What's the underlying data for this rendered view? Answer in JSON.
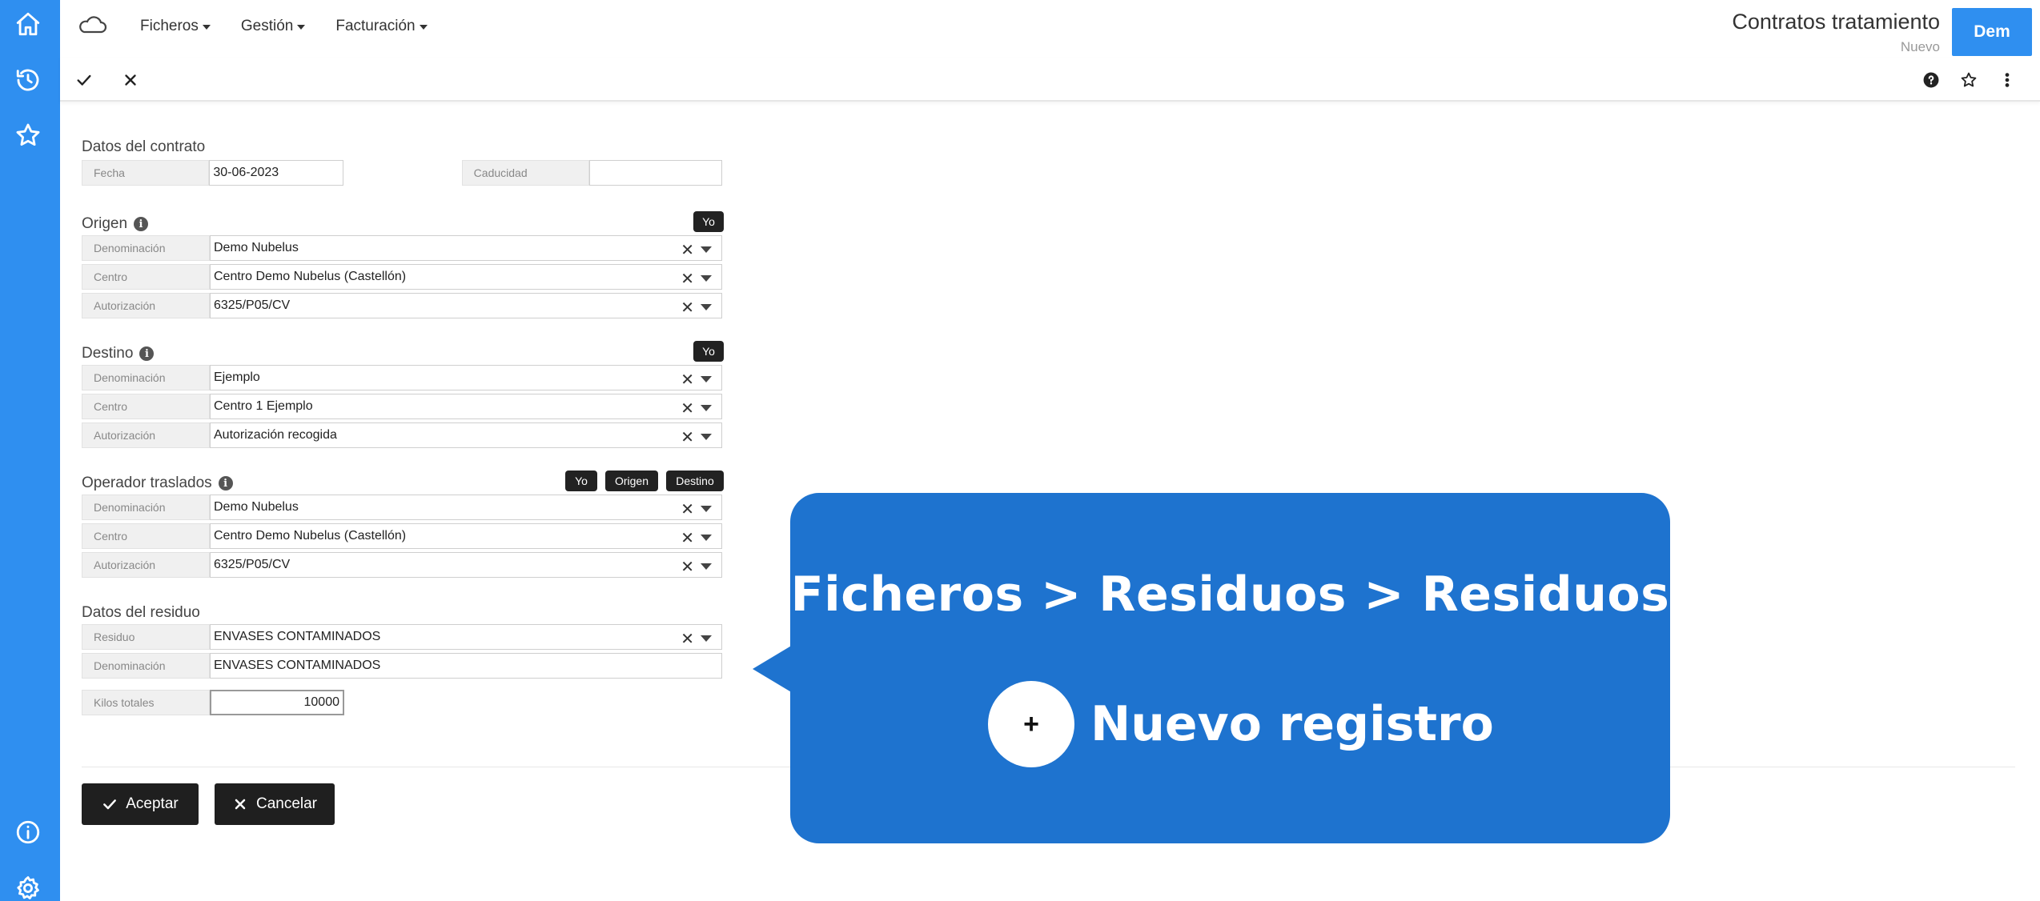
{
  "app": {
    "icons": {
      "logo": "cloud-logo-icon",
      "home": "home-icon",
      "history": "history-icon",
      "favorites": "star-icon",
      "info": "info-icon",
      "settings": "gear-icon"
    },
    "accent_color": "#2f8ff0"
  },
  "menu": [
    {
      "label": "Ficheros"
    },
    {
      "label": "Gestión"
    },
    {
      "label": "Facturación"
    }
  ],
  "header": {
    "title": "Contratos tratamiento",
    "status": "Nuevo",
    "user_label": "Dem"
  },
  "toolbar": {
    "confirm_icon": "check-icon",
    "cancel_icon": "close-icon",
    "help_icon": "help-icon",
    "favorite_icon": "star-icon",
    "more_icon": "more-vertical-icon"
  },
  "contract": {
    "title": "Datos del contrato",
    "date_label": "Fecha",
    "date_value": "30-06-2023",
    "expiry_label": "Caducidad",
    "expiry_value": ""
  },
  "origin": {
    "title": "Origen",
    "button_yo": "Yo",
    "rows": [
      {
        "label": "Denominación",
        "value": "Demo Nubelus"
      },
      {
        "label": "Centro",
        "value": "Centro Demo Nubelus (Castellón)"
      },
      {
        "label": "Autorización",
        "value": "6325/P05/CV"
      }
    ]
  },
  "destination": {
    "title": "Destino",
    "button_yo": "Yo",
    "rows": [
      {
        "label": "Denominación",
        "value": "Ejemplo"
      },
      {
        "label": "Centro",
        "value": "Centro 1 Ejemplo"
      },
      {
        "label": "Autorización",
        "value": "Autorización recogida"
      }
    ]
  },
  "operator": {
    "title": "Operador traslados",
    "button_yo": "Yo",
    "button_origin": "Origen",
    "button_destination": "Destino",
    "rows": [
      {
        "label": "Denominación",
        "value": "Demo Nubelus"
      },
      {
        "label": "Centro",
        "value": "Centro Demo Nubelus (Castellón)"
      },
      {
        "label": "Autorización",
        "value": "6325/P05/CV"
      }
    ]
  },
  "waste": {
    "title": "Datos del residuo",
    "residue_label": "Residuo",
    "residue_value": "ENVASES CONTAMINADOS",
    "denomination_label": "Denominación",
    "denomination_value": "ENVASES CONTAMINADOS",
    "kilos_label": "Kilos totales",
    "kilos_value": "10000"
  },
  "actions": {
    "accept": "Aceptar",
    "cancel": "Cancelar"
  },
  "callout": {
    "path": "Ficheros > Residuos > Residuos",
    "plus": "+",
    "label": "Nuevo registro",
    "color": "#1e73cf"
  }
}
